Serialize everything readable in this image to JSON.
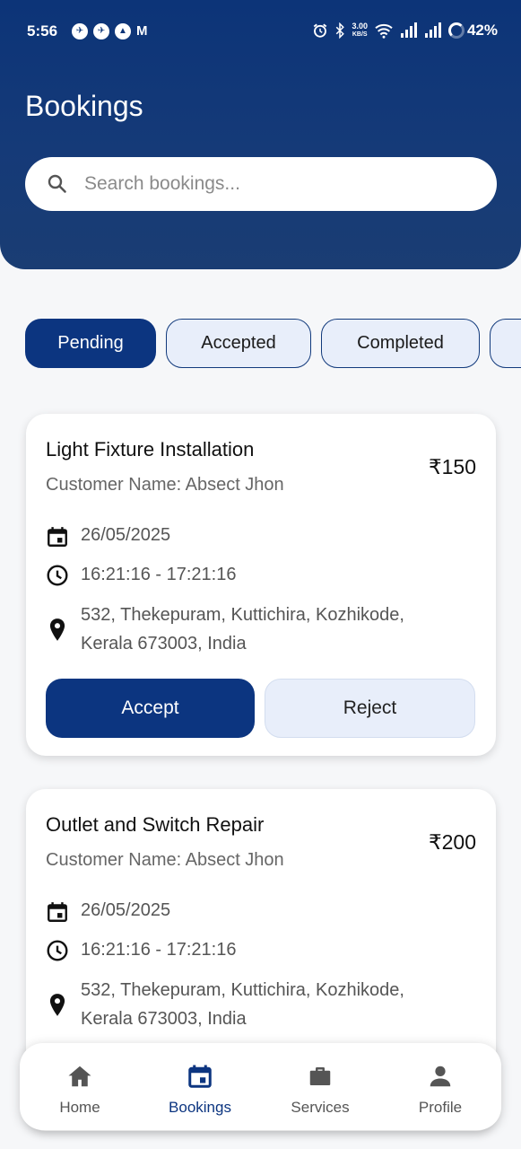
{
  "status_bar": {
    "time": "5:56",
    "speed_value": "3.00",
    "speed_unit": "KB/S",
    "battery": "42%",
    "app_icons": [
      "notification-icon",
      "notification-icon",
      "navigation-icon",
      "gmail-icon"
    ],
    "system_icons": [
      "alarm-icon",
      "bluetooth-icon",
      "wifi-icon",
      "signal-icon",
      "signal-icon",
      "battery-icon"
    ]
  },
  "header": {
    "title": "Bookings",
    "search_placeholder": "Search bookings..."
  },
  "filters": {
    "chips": [
      "Pending",
      "Accepted",
      "Completed"
    ],
    "active": "Pending"
  },
  "bookings": [
    {
      "title": "Light Fixture Installation",
      "price": "₹150",
      "customer": "Customer Name: Absect Jhon",
      "date": "26/05/2025",
      "time": "16:21:16 - 17:21:16",
      "address_line1": "532, Thekepuram, Kuttichira, Kozhikode,",
      "address_line2": "Kerala 673003, India",
      "accept_label": "Accept",
      "reject_label": "Reject"
    },
    {
      "title": "Outlet and Switch Repair",
      "price": "₹200",
      "customer": "Customer Name: Absect Jhon",
      "date": "26/05/2025",
      "time": "16:21:16 - 17:21:16",
      "address_line1": "532, Thekepuram, Kuttichira, Kozhikode,",
      "address_line2": "Kerala 673003, India"
    }
  ],
  "bottom_nav": {
    "items": [
      {
        "label": "Home",
        "icon": "home-icon"
      },
      {
        "label": "Bookings",
        "icon": "calendar-icon"
      },
      {
        "label": "Services",
        "icon": "briefcase-icon"
      },
      {
        "label": "Profile",
        "icon": "person-icon"
      }
    ],
    "active": "Bookings"
  },
  "colors": {
    "primary": "#0c3580",
    "chip_bg": "#e8eefa",
    "header_gradient_top": "#0c3478",
    "header_gradient_bottom": "#1a3d73"
  }
}
